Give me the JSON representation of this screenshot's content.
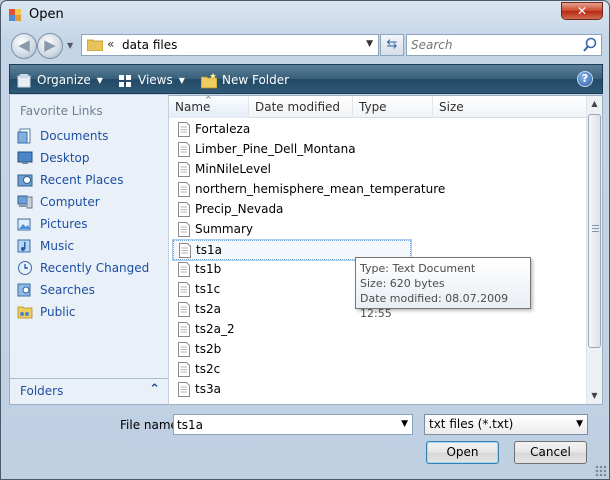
{
  "window": {
    "title": "Open",
    "close_label": "✕"
  },
  "address": {
    "path_chevron": "«",
    "path": "data files"
  },
  "search": {
    "placeholder": "Search"
  },
  "toolbar": {
    "organize": "Organize",
    "views": "Views",
    "new_folder": "New Folder",
    "help": "?"
  },
  "favorites": {
    "title": "Favorite Links",
    "items": [
      {
        "label": "Documents",
        "icon": "documents-icon"
      },
      {
        "label": "Desktop",
        "icon": "desktop-icon"
      },
      {
        "label": "Recent Places",
        "icon": "recent-places-icon"
      },
      {
        "label": "Computer",
        "icon": "computer-icon"
      },
      {
        "label": "Pictures",
        "icon": "pictures-icon"
      },
      {
        "label": "Music",
        "icon": "music-icon"
      },
      {
        "label": "Recently Changed",
        "icon": "recently-changed-icon"
      },
      {
        "label": "Searches",
        "icon": "searches-icon"
      },
      {
        "label": "Public",
        "icon": "public-folder-icon"
      }
    ],
    "folders_label": "Folders"
  },
  "columns": {
    "name": "Name",
    "date": "Date modified",
    "type": "Type",
    "size": "Size"
  },
  "files": [
    "Fortaleza",
    "Limber_Pine_Dell_Montana",
    "MinNileLevel",
    "northern_hemisphere_mean_temperature",
    "Precip_Nevada",
    "Summary",
    "ts1a",
    "ts1b",
    "ts1c",
    "ts2a",
    "ts2a_2",
    "ts2b",
    "ts2c",
    "ts3a"
  ],
  "selected_file": "ts1a",
  "tooltip": {
    "type": "Type: Text Document",
    "size": "Size: 620 bytes",
    "date": "Date modified: 08.07.2009 12:55"
  },
  "bottom": {
    "file_name_label": "File name:",
    "file_name_value": "ts1a",
    "filter": "txt files (*.txt)",
    "open": "Open",
    "cancel": "Cancel"
  }
}
